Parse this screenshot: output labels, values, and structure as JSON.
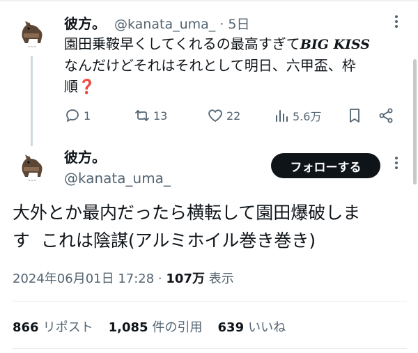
{
  "reply_tweet": {
    "name": "彼方。",
    "handle_time": "@kanata_uma_ · 5日",
    "text_line1": "園田乗鞍早くしてくれるの最高すぎて",
    "big_kiss": "BIG KISS",
    "text_line2": "なんだけどそれはそれとして明日、六甲盃、枠",
    "text_line3": "順❓",
    "actions": {
      "reply_count": "1",
      "retweet_count": "13",
      "like_count": "22",
      "views_count": "5.6万"
    }
  },
  "main_tweet": {
    "name": "彼方。",
    "handle": "@kanata_uma_",
    "follow_label": "フォローする",
    "text_line1": "大外とか最内だったら横転して園田爆破しま",
    "text_line2": "す  これは陰謀(アルミホイル巻き巻き)",
    "meta": {
      "datetime": "2024年06月01日 17:28 · ",
      "views": "107万",
      "views_label": " 表示"
    },
    "stats": {
      "reposts": "866",
      "reposts_label": "リポスト",
      "quotes": "1,085",
      "quotes_label": "件の引用",
      "likes": "639",
      "likes_label": "いいね"
    }
  },
  "colors": {
    "text": "#0f1419",
    "secondary": "#536471",
    "follow_bg": "#0f1419",
    "thread_line": "#cfd9de"
  }
}
